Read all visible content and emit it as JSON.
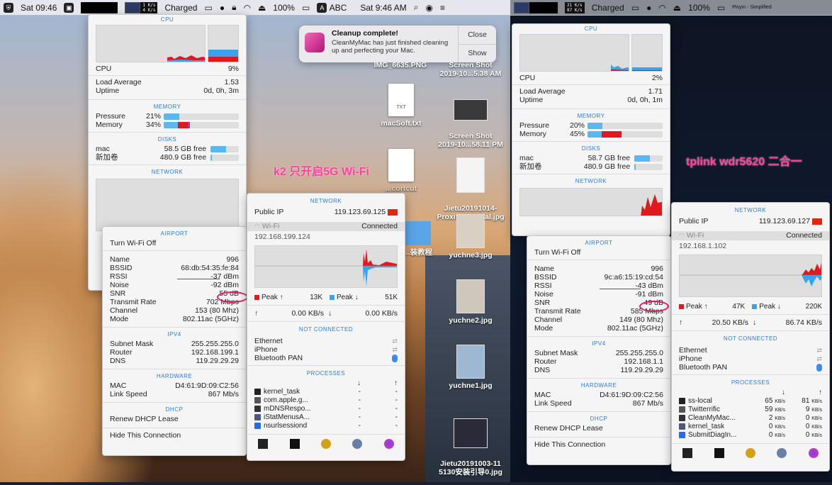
{
  "menubar_left": {
    "day_time": "Sat 09:46",
    "netstats_left": "1 K/s\n4 K/s",
    "battery_status": "Charged",
    "battery_pct": "100%",
    "input_a": "A",
    "input_label": "ABC",
    "clock": "Sat 9:46 AM"
  },
  "menubar_right": {
    "netstats_a": "21 K/s\n87 K/s",
    "battery_status": "Charged",
    "battery_pct": "100%",
    "input_label": "Pinyin - Simplified"
  },
  "notification": {
    "title": "Cleanup complete!",
    "body": "CleanMyMac has just finished cleaning up and perfecting your Mac.",
    "close": "Close",
    "show": "Show"
  },
  "annotations": {
    "left": "k2 只开启5G Wi-Fi",
    "right": "tplink wdr5620 二合一"
  },
  "desktop_icons": [
    {
      "name": "IMG_6635.PNG"
    },
    {
      "name": "Screen Shot\n2019-10...5.38 AM"
    },
    {
      "name": "macSoft.txt",
      "doc": "TXT"
    },
    {
      "name": "Screen Shot\n2019-10...58.11 PM"
    },
    {
      "name": "...cortcut"
    },
    {
      "name": "Jietu20191014-\nProxifier...torial.jpg"
    },
    {
      "name": "yuchne3.jpg"
    },
    {
      "name": "...装教程"
    },
    {
      "name": "yuchne2.jpg"
    },
    {
      "name": "yuchne1.jpg"
    },
    {
      "name": "Jietu20191003-11\n5130安装引导0.jpg"
    }
  ],
  "left_stats": {
    "cpu": {
      "section": "CPU",
      "label": "CPU",
      "value": "9%",
      "load_label": "Load Average",
      "load_value": "1.53",
      "uptime_label": "Uptime",
      "uptime_value": "0d, 0h, 3m"
    },
    "memory": {
      "section": "MEMORY",
      "pressure_label": "Pressure",
      "pressure_value": "21%",
      "pressure_fraction": 0.21,
      "memory_label": "Memory",
      "memory_value": "34%",
      "memory_fraction": 0.34
    },
    "disks": {
      "section": "DISKS",
      "d1_name": "mac",
      "d1_value": "58.5 GB free",
      "d2_name": "新加卷",
      "d2_value": "480.9 GB free"
    },
    "network_section": "NETWORK"
  },
  "left_airport": {
    "section": "AIRPORT",
    "turn_off": "Turn Wi-Fi Off",
    "rows": [
      {
        "k": "Name",
        "v": "996"
      },
      {
        "k": "BSSID",
        "v": "68:db:54:35:fe:84"
      },
      {
        "k": "RSSI",
        "v": "-37 dBm"
      },
      {
        "k": "Noise",
        "v": "-92 dBm"
      },
      {
        "k": "SNR",
        "v": "55 dB"
      },
      {
        "k": "Transmit Rate",
        "v": "702 Mbps"
      },
      {
        "k": "Channel",
        "v": "153 (80 Mhz)"
      },
      {
        "k": "Mode",
        "v": "802.11ac (5GHz)"
      }
    ],
    "ipv4_section": "IPV4",
    "ipv4": [
      {
        "k": "Subnet Mask",
        "v": "255.255.255.0"
      },
      {
        "k": "Router",
        "v": "192.168.199.1"
      },
      {
        "k": "DNS",
        "v": "119.29.29.29"
      }
    ],
    "hw_section": "HARDWARE",
    "hw": [
      {
        "k": "MAC",
        "v": "D4:61:9D:09:C2:56"
      },
      {
        "k": "Link Speed",
        "v": "867 Mb/s"
      }
    ],
    "dhcp_section": "DHCP",
    "renew": "Renew DHCP Lease",
    "hide": "Hide This Connection"
  },
  "left_network": {
    "section": "NETWORK",
    "public_ip_label": "Public IP",
    "public_ip": "119.123.69.125",
    "wifi_label": "Wi-Fi",
    "wifi_status": "Connected",
    "local_ip": "192.168.199.124",
    "peak_up_label": "Peak ↑",
    "peak_up": "13K",
    "peak_down_label": "Peak ↓",
    "peak_down": "51K",
    "rate_up": "0.00 KB/s",
    "rate_down": "0.00 KB/s",
    "not_connected": "NOT CONNECTED",
    "ifaces": [
      "Ethernet",
      "iPhone",
      "Bluetooth PAN"
    ],
    "processes_section": "PROCESSES",
    "processes": [
      {
        "name": "kernel_task",
        "down": "-",
        "up": "-"
      },
      {
        "name": "com.apple.g...",
        "down": "-",
        "up": "-"
      },
      {
        "name": "mDNSRespo...",
        "down": "-",
        "up": "-"
      },
      {
        "name": "iStatMenusA...",
        "down": "-",
        "up": "-"
      },
      {
        "name": "nsurlsessiond",
        "down": "-",
        "up": "-"
      }
    ]
  },
  "right_stats": {
    "cpu": {
      "section": "CPU",
      "label": "CPU",
      "value": "2%",
      "load_label": "Load Average",
      "load_value": "1.71",
      "uptime_label": "Uptime",
      "uptime_value": "0d, 0h, 1m"
    },
    "memory": {
      "section": "MEMORY",
      "pressure_label": "Pressure",
      "pressure_value": "20%",
      "pressure_fraction": 0.2,
      "memory_label": "Memory",
      "memory_value": "45%",
      "memory_fraction": 0.45
    },
    "disks": {
      "section": "DISKS",
      "d1_name": "mac",
      "d1_value": "58.7 GB free",
      "d2_name": "新加卷",
      "d2_value": "480.9 GB free"
    },
    "network_section": "NETWORK"
  },
  "right_airport": {
    "section": "AIRPORT",
    "turn_off": "Turn Wi-Fi Off",
    "rows": [
      {
        "k": "Name",
        "v": "996"
      },
      {
        "k": "BSSID",
        "v": "9c:a6:15:19:cd:54"
      },
      {
        "k": "RSSI",
        "v": "-43 dBm"
      },
      {
        "k": "Noise",
        "v": "-91 dBm"
      },
      {
        "k": "SNR",
        "v": "49 dB"
      },
      {
        "k": "Transmit Rate",
        "v": "585 Mbps"
      },
      {
        "k": "Channel",
        "v": "149 (80 Mhz)"
      },
      {
        "k": "Mode",
        "v": "802.11ac (5GHz)"
      }
    ],
    "ipv4_section": "IPV4",
    "ipv4": [
      {
        "k": "Subnet Mask",
        "v": "255.255.255.0"
      },
      {
        "k": "Router",
        "v": "192.168.1.1"
      },
      {
        "k": "DNS",
        "v": "119.29.29.29"
      }
    ],
    "hw_section": "HARDWARE",
    "hw": [
      {
        "k": "MAC",
        "v": "D4:61:9D:09:C2:56"
      },
      {
        "k": "Link Speed",
        "v": "867 Mb/s"
      }
    ],
    "dhcp_section": "DHCP",
    "renew": "Renew DHCP Lease",
    "hide": "Hide This Connection"
  },
  "right_network": {
    "section": "NETWORK",
    "public_ip_label": "Public IP",
    "public_ip": "119.123.69.127",
    "wifi_label": "Wi-Fi",
    "wifi_status": "Connected",
    "local_ip": "192.168.1.102",
    "peak_up_label": "Peak ↑",
    "peak_up": "47K",
    "peak_down_label": "Peak ↓",
    "peak_down": "220K",
    "rate_up": "20.50 KB/s",
    "rate_down": "86.74 KB/s",
    "not_connected": "NOT CONNECTED",
    "ifaces": [
      "Ethernet",
      "iPhone",
      "Bluetooth PAN"
    ],
    "processes_section": "PROCESSES",
    "processes": [
      {
        "name": "ss-local",
        "down": "65",
        "up": "81"
      },
      {
        "name": "Twitterrific",
        "down": "59",
        "up": "9"
      },
      {
        "name": "CleanMyMac...",
        "down": "2",
        "up": "0"
      },
      {
        "name": "kernel_task",
        "down": "0",
        "up": "0"
      },
      {
        "name": "SubmitDiagIn...",
        "down": "0",
        "up": "0"
      }
    ],
    "unit": "KB/s"
  },
  "colors": {
    "upload": "#e0191f",
    "download": "#3aa3f0",
    "accent": "#2b7bd6",
    "highlight": "#e0195a"
  }
}
